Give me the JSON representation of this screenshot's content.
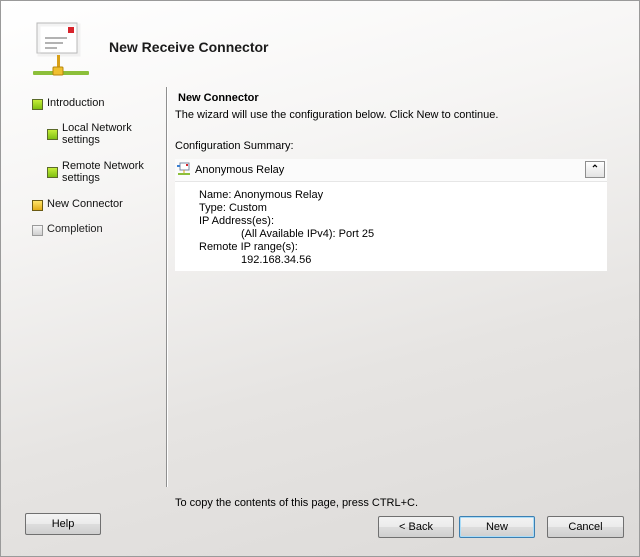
{
  "window": {
    "title": "New Receive Connector"
  },
  "nav": {
    "items": [
      {
        "label": "Introduction",
        "status": "complete"
      },
      {
        "label": "Local Network settings",
        "status": "complete"
      },
      {
        "label": "Remote Network settings",
        "status": "complete"
      },
      {
        "label": "New Connector",
        "status": "current"
      },
      {
        "label": "Completion",
        "status": "pending"
      }
    ]
  },
  "main": {
    "title": "New Connector",
    "description": "The wizard will use the configuration below.  Click New to continue.",
    "summary_label": "Configuration Summary:",
    "summary": {
      "title": "Anonymous Relay",
      "icon": "connector-icon",
      "lines": [
        "Name: Anonymous Relay",
        "Type: Custom",
        "IP Address(es):",
        "(All Available IPv4): Port 25",
        "Remote IP range(s):",
        "192.168.34.56"
      ]
    }
  },
  "footer": {
    "copy_note": "To copy the contents of this page, press CTRL+C.",
    "help_label": "Help",
    "back_label": "< Back",
    "new_label": "New",
    "cancel_label": "Cancel"
  },
  "colors": {
    "complete": "#8cc61a",
    "current": "#f0c030",
    "pending": "#d6d6d6",
    "default_button_border": "#3c7fb1"
  }
}
